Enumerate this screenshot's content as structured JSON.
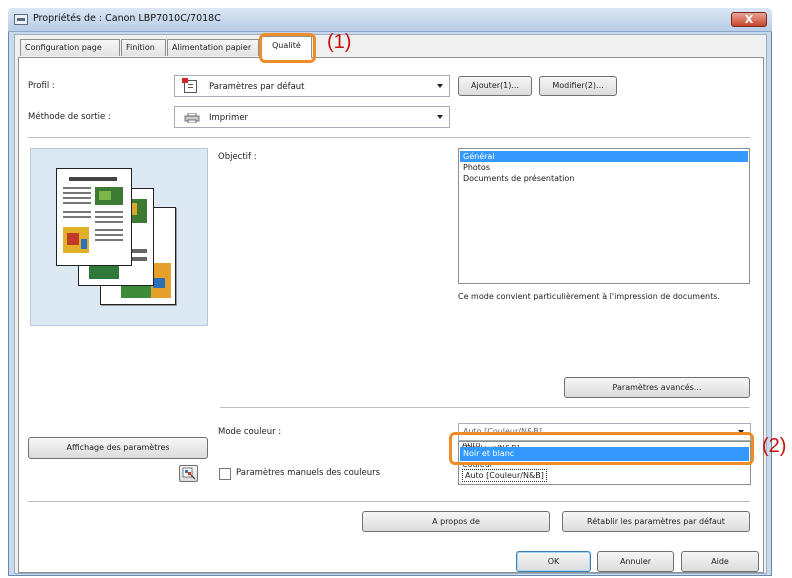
{
  "window": {
    "title": "Propriétés de : Canon LBP7010C/7018C",
    "close_label": "X"
  },
  "tabs": [
    {
      "label": "Configuration page"
    },
    {
      "label": "Finition"
    },
    {
      "label": "Alimentation papier"
    },
    {
      "label": "Qualité"
    }
  ],
  "active_tab": "Qualité",
  "callouts": {
    "one": "(1)",
    "two": "(2)"
  },
  "profile": {
    "label": "Profil :",
    "value": "Paramètres par défaut",
    "add_label": "Ajouter(1)...",
    "edit_label": "Modifier(2)..."
  },
  "output_method": {
    "label": "Méthode de sortie :",
    "value": "Imprimer"
  },
  "objective": {
    "label": "Objectif :",
    "items": [
      "Général",
      "Photos",
      "Documents de présentation"
    ],
    "selected": "Général",
    "description": "Ce mode convient particulièrement à l'impression de documents."
  },
  "advanced_settings_label": "Paramètres avancés...",
  "color_mode": {
    "label": "Mode couleur :",
    "current_value": "Auto [Couleur/N&B]",
    "options": [
      "Noir et blanc",
      "Couleur",
      "Auto [Couleur/N&B]"
    ],
    "highlighted": "Noir et blanc"
  },
  "show_settings_label": "Affichage des paramètres",
  "manual_color": {
    "label": "Paramètres manuels des couleurs",
    "checked": false
  },
  "about_label": "A propos de",
  "restore_defaults_label": "Rétablir les paramètres par défaut",
  "dialog_buttons": {
    "ok": "OK",
    "cancel": "Annuler",
    "help": "Aide"
  },
  "colors": {
    "accent_orange": "#f08c28",
    "callout_red": "#c8120e",
    "selection_blue": "#3399ff",
    "title_bar": "#c9d9ec"
  }
}
